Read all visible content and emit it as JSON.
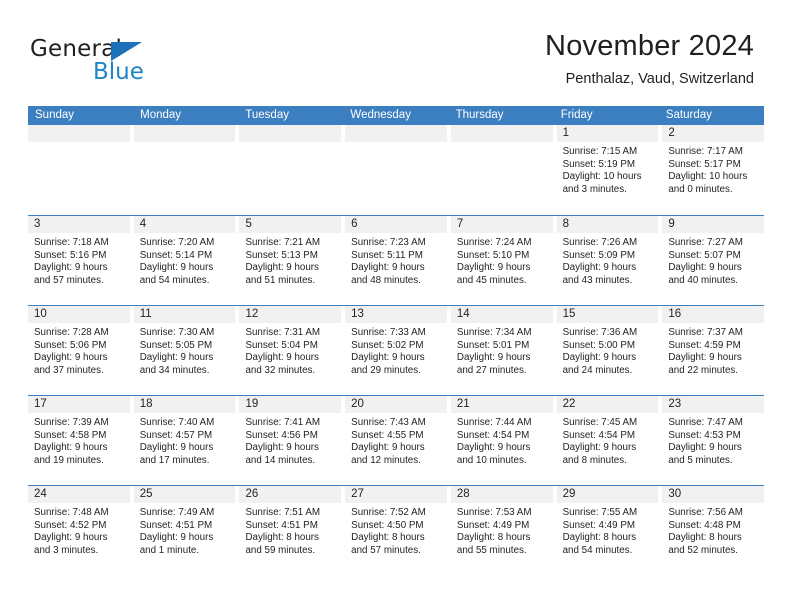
{
  "brand": {
    "name_part1": "General",
    "name_part2": "Blue",
    "triangle_color": "#1d71b8",
    "blue_color": "#1d85c6"
  },
  "header": {
    "title": "November 2024",
    "subtitle": "Penthalaz, Vaud, Switzerland"
  },
  "theme": {
    "header_blue": "#3c7fc1",
    "day_strip_gray": "#f1f1f1",
    "text_color": "#231f20"
  },
  "weekdays": [
    "Sunday",
    "Monday",
    "Tuesday",
    "Wednesday",
    "Thursday",
    "Friday",
    "Saturday"
  ],
  "weeks": [
    [
      {
        "day": "",
        "empty": true
      },
      {
        "day": "",
        "empty": true
      },
      {
        "day": "",
        "empty": true
      },
      {
        "day": "",
        "empty": true
      },
      {
        "day": "",
        "empty": true
      },
      {
        "day": "1",
        "sunrise": "Sunrise: 7:15 AM",
        "sunset": "Sunset: 5:19 PM",
        "daylight1": "Daylight: 10 hours",
        "daylight2": "and 3 minutes."
      },
      {
        "day": "2",
        "sunrise": "Sunrise: 7:17 AM",
        "sunset": "Sunset: 5:17 PM",
        "daylight1": "Daylight: 10 hours",
        "daylight2": "and 0 minutes."
      }
    ],
    [
      {
        "day": "3",
        "sunrise": "Sunrise: 7:18 AM",
        "sunset": "Sunset: 5:16 PM",
        "daylight1": "Daylight: 9 hours",
        "daylight2": "and 57 minutes."
      },
      {
        "day": "4",
        "sunrise": "Sunrise: 7:20 AM",
        "sunset": "Sunset: 5:14 PM",
        "daylight1": "Daylight: 9 hours",
        "daylight2": "and 54 minutes."
      },
      {
        "day": "5",
        "sunrise": "Sunrise: 7:21 AM",
        "sunset": "Sunset: 5:13 PM",
        "daylight1": "Daylight: 9 hours",
        "daylight2": "and 51 minutes."
      },
      {
        "day": "6",
        "sunrise": "Sunrise: 7:23 AM",
        "sunset": "Sunset: 5:11 PM",
        "daylight1": "Daylight: 9 hours",
        "daylight2": "and 48 minutes."
      },
      {
        "day": "7",
        "sunrise": "Sunrise: 7:24 AM",
        "sunset": "Sunset: 5:10 PM",
        "daylight1": "Daylight: 9 hours",
        "daylight2": "and 45 minutes."
      },
      {
        "day": "8",
        "sunrise": "Sunrise: 7:26 AM",
        "sunset": "Sunset: 5:09 PM",
        "daylight1": "Daylight: 9 hours",
        "daylight2": "and 43 minutes."
      },
      {
        "day": "9",
        "sunrise": "Sunrise: 7:27 AM",
        "sunset": "Sunset: 5:07 PM",
        "daylight1": "Daylight: 9 hours",
        "daylight2": "and 40 minutes."
      }
    ],
    [
      {
        "day": "10",
        "sunrise": "Sunrise: 7:28 AM",
        "sunset": "Sunset: 5:06 PM",
        "daylight1": "Daylight: 9 hours",
        "daylight2": "and 37 minutes."
      },
      {
        "day": "11",
        "sunrise": "Sunrise: 7:30 AM",
        "sunset": "Sunset: 5:05 PM",
        "daylight1": "Daylight: 9 hours",
        "daylight2": "and 34 minutes."
      },
      {
        "day": "12",
        "sunrise": "Sunrise: 7:31 AM",
        "sunset": "Sunset: 5:04 PM",
        "daylight1": "Daylight: 9 hours",
        "daylight2": "and 32 minutes."
      },
      {
        "day": "13",
        "sunrise": "Sunrise: 7:33 AM",
        "sunset": "Sunset: 5:02 PM",
        "daylight1": "Daylight: 9 hours",
        "daylight2": "and 29 minutes."
      },
      {
        "day": "14",
        "sunrise": "Sunrise: 7:34 AM",
        "sunset": "Sunset: 5:01 PM",
        "daylight1": "Daylight: 9 hours",
        "daylight2": "and 27 minutes."
      },
      {
        "day": "15",
        "sunrise": "Sunrise: 7:36 AM",
        "sunset": "Sunset: 5:00 PM",
        "daylight1": "Daylight: 9 hours",
        "daylight2": "and 24 minutes."
      },
      {
        "day": "16",
        "sunrise": "Sunrise: 7:37 AM",
        "sunset": "Sunset: 4:59 PM",
        "daylight1": "Daylight: 9 hours",
        "daylight2": "and 22 minutes."
      }
    ],
    [
      {
        "day": "17",
        "sunrise": "Sunrise: 7:39 AM",
        "sunset": "Sunset: 4:58 PM",
        "daylight1": "Daylight: 9 hours",
        "daylight2": "and 19 minutes."
      },
      {
        "day": "18",
        "sunrise": "Sunrise: 7:40 AM",
        "sunset": "Sunset: 4:57 PM",
        "daylight1": "Daylight: 9 hours",
        "daylight2": "and 17 minutes."
      },
      {
        "day": "19",
        "sunrise": "Sunrise: 7:41 AM",
        "sunset": "Sunset: 4:56 PM",
        "daylight1": "Daylight: 9 hours",
        "daylight2": "and 14 minutes."
      },
      {
        "day": "20",
        "sunrise": "Sunrise: 7:43 AM",
        "sunset": "Sunset: 4:55 PM",
        "daylight1": "Daylight: 9 hours",
        "daylight2": "and 12 minutes."
      },
      {
        "day": "21",
        "sunrise": "Sunrise: 7:44 AM",
        "sunset": "Sunset: 4:54 PM",
        "daylight1": "Daylight: 9 hours",
        "daylight2": "and 10 minutes."
      },
      {
        "day": "22",
        "sunrise": "Sunrise: 7:45 AM",
        "sunset": "Sunset: 4:54 PM",
        "daylight1": "Daylight: 9 hours",
        "daylight2": "and 8 minutes."
      },
      {
        "day": "23",
        "sunrise": "Sunrise: 7:47 AM",
        "sunset": "Sunset: 4:53 PM",
        "daylight1": "Daylight: 9 hours",
        "daylight2": "and 5 minutes."
      }
    ],
    [
      {
        "day": "24",
        "sunrise": "Sunrise: 7:48 AM",
        "sunset": "Sunset: 4:52 PM",
        "daylight1": "Daylight: 9 hours",
        "daylight2": "and 3 minutes."
      },
      {
        "day": "25",
        "sunrise": "Sunrise: 7:49 AM",
        "sunset": "Sunset: 4:51 PM",
        "daylight1": "Daylight: 9 hours",
        "daylight2": "and 1 minute."
      },
      {
        "day": "26",
        "sunrise": "Sunrise: 7:51 AM",
        "sunset": "Sunset: 4:51 PM",
        "daylight1": "Daylight: 8 hours",
        "daylight2": "and 59 minutes."
      },
      {
        "day": "27",
        "sunrise": "Sunrise: 7:52 AM",
        "sunset": "Sunset: 4:50 PM",
        "daylight1": "Daylight: 8 hours",
        "daylight2": "and 57 minutes."
      },
      {
        "day": "28",
        "sunrise": "Sunrise: 7:53 AM",
        "sunset": "Sunset: 4:49 PM",
        "daylight1": "Daylight: 8 hours",
        "daylight2": "and 55 minutes."
      },
      {
        "day": "29",
        "sunrise": "Sunrise: 7:55 AM",
        "sunset": "Sunset: 4:49 PM",
        "daylight1": "Daylight: 8 hours",
        "daylight2": "and 54 minutes."
      },
      {
        "day": "30",
        "sunrise": "Sunrise: 7:56 AM",
        "sunset": "Sunset: 4:48 PM",
        "daylight1": "Daylight: 8 hours",
        "daylight2": "and 52 minutes."
      }
    ]
  ]
}
